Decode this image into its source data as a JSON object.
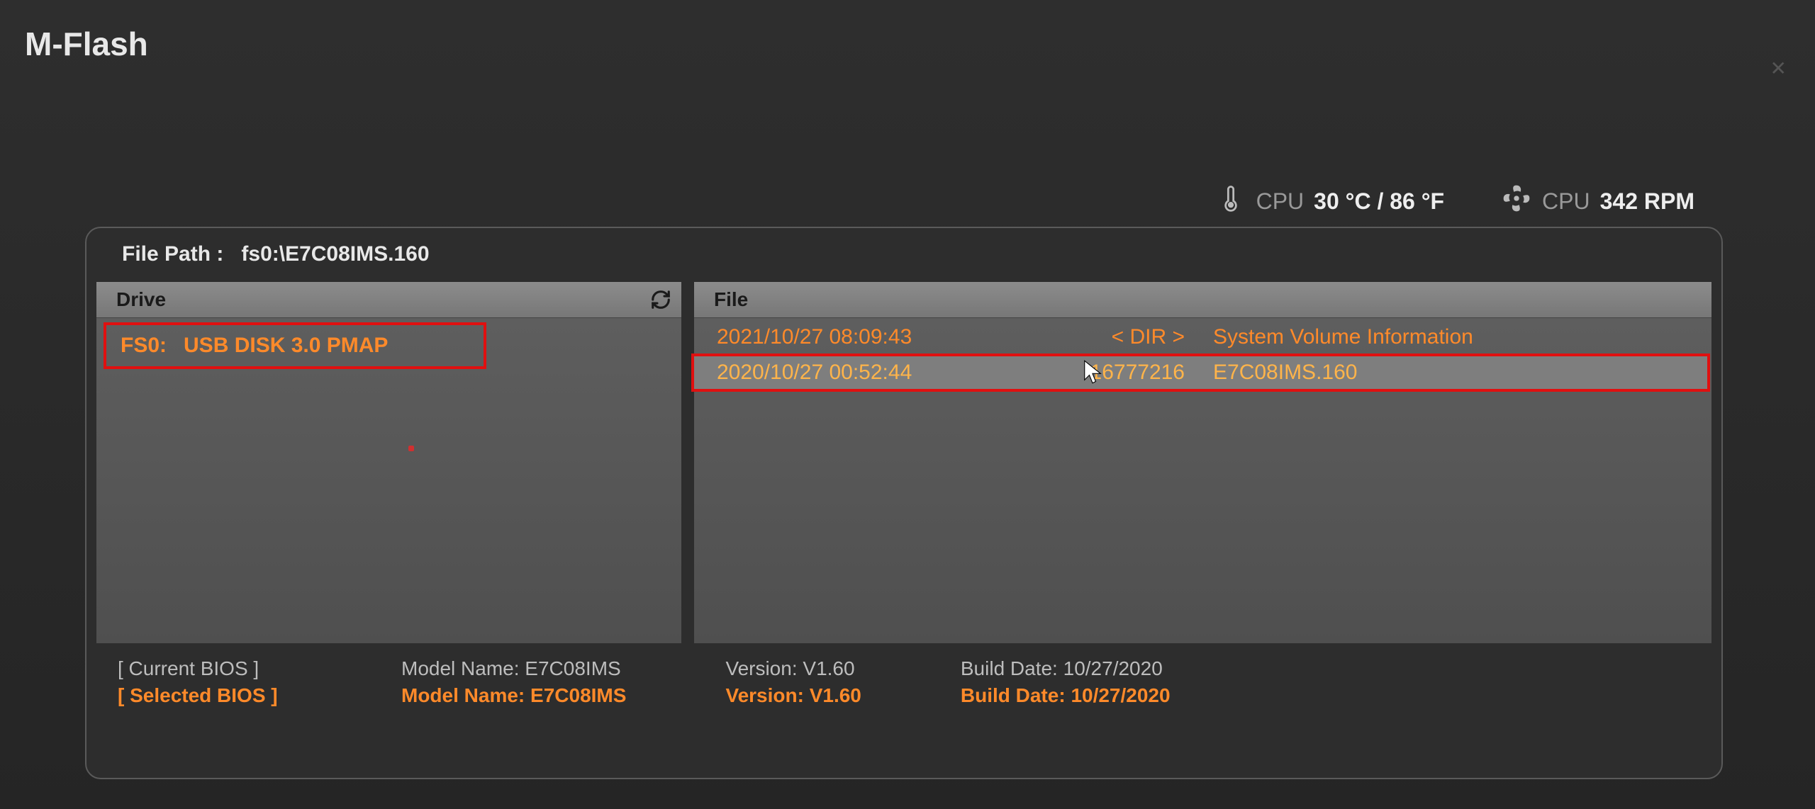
{
  "title": "M-Flash",
  "stats": {
    "temp_label": "CPU",
    "temp_value": "30 °C / 86 °F",
    "fan_label": "CPU",
    "fan_value": "342 RPM"
  },
  "file_path_label": "File Path :",
  "file_path_value": "fs0:\\E7C08IMS.160",
  "headers": {
    "drive": "Drive",
    "file": "File"
  },
  "drive_row": {
    "id": "FS0:",
    "name": "USB DISK 3.0 PMAP"
  },
  "file_rows": [
    {
      "date": "2021/10/27 08:09:43",
      "size": "< DIR >",
      "name": "System Volume Information",
      "selected": false
    },
    {
      "date": "2020/10/27 00:52:44",
      "size": "16777216",
      "name": "E7C08IMS.160",
      "selected": true
    }
  ],
  "footer": {
    "current_label": "[ Current BIOS  ]",
    "selected_label": "[ Selected BIOS ]",
    "model_label": "Model Name:",
    "version_label": "Version:",
    "build_label": "Build Date:",
    "current_model": "E7C08IMS",
    "current_version": "V1.60",
    "current_build": "10/27/2020",
    "selected_model": "E7C08IMS",
    "selected_version": "V1.60",
    "selected_build": "10/27/2020"
  }
}
